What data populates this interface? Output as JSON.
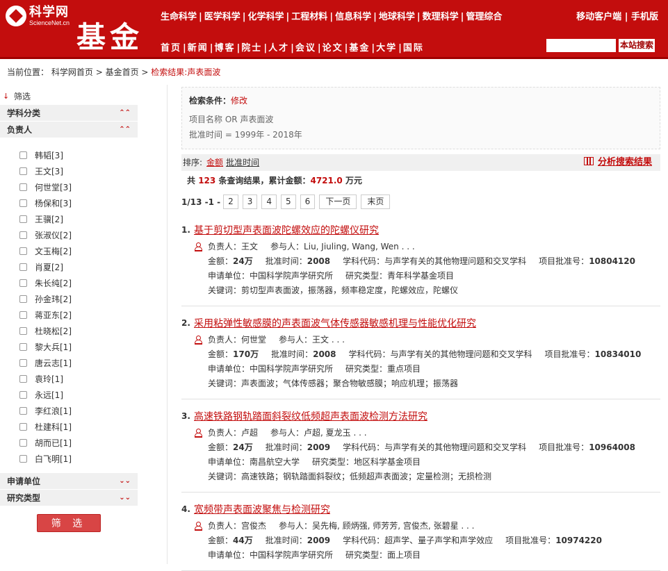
{
  "header": {
    "logo_name": "科学网",
    "logo_sub": "ScienceNet.cn",
    "section": "基金",
    "top_nav": [
      "生命科学",
      "医学科学",
      "化学科学",
      "工程材料",
      "信息科学",
      "地球科学",
      "数理科学",
      "管理综合"
    ],
    "top_right": [
      "移动客户端",
      "手机版"
    ],
    "main_nav": [
      "首页",
      "新闻",
      "博客",
      "院士",
      "人才",
      "会议",
      "论文",
      "基金",
      "大学",
      "国际"
    ],
    "search_value": "",
    "search_button": "本站搜索"
  },
  "breadcrumb": {
    "prefix": "当前位置：",
    "items": [
      "科学网首页",
      "基金首页"
    ],
    "current": "检索结果:声表面波"
  },
  "sidebar": {
    "filter_label": "筛选",
    "categories": [
      {
        "label": "学科分类",
        "chevron": "up"
      },
      {
        "label": "负责人",
        "chevron": "up"
      }
    ],
    "people": [
      "韩韬[3]",
      "王文[3]",
      "何世堂[3]",
      "杨保和[3]",
      "王骥[2]",
      "张淑仪[2]",
      "文玉梅[2]",
      "肖夏[2]",
      "朱长纯[2]",
      "孙金玮[2]",
      "蒋亚东[2]",
      "杜晓松[2]",
      "黎大兵[1]",
      "唐云志[1]",
      "袁玲[1]",
      "永远[1]",
      "李红浪[1]",
      "杜建科[1]",
      "胡而已[1]",
      "白飞明[1]"
    ],
    "bottom_categories": [
      {
        "label": "申请单位",
        "chevron": "down"
      },
      {
        "label": "研究类型",
        "chevron": "down"
      }
    ],
    "filter_button": "筛 选"
  },
  "conditions": {
    "title": "检索条件：",
    "edit": "修改",
    "line1": "项目名称 OR 声表面波",
    "line2": "批准时间 = 1999年 - 2018年"
  },
  "sort": {
    "label": "排序:",
    "option1": "金额",
    "option2": "批准时间",
    "analyze": "分析搜索结果"
  },
  "summary": {
    "pre": "共",
    "count": "123",
    "mid": "条查询结果，累计金额：",
    "amount": "4721.0",
    "unit": "万元"
  },
  "pager": {
    "info": "1/13 -1 -",
    "pages": [
      "2",
      "3",
      "4",
      "5",
      "6"
    ],
    "next": "下一页",
    "last": "末页"
  },
  "results": [
    {
      "idx": "1.",
      "title": "基于剪切型声表面波陀螺效应的陀螺仪研究",
      "leader": "王文",
      "participants": "Liu, Jiuling, Wang, Wen . . .",
      "amount": "24万",
      "year": "2008",
      "subject_code": "与声学有关的其他物理问题和交叉学科",
      "approval_no": "10804120",
      "org": "中国科学院声学研究所",
      "type": "青年科学基金项目",
      "keywords": "剪切型声表面波，振荡器，频率稳定度，陀螺效应，陀螺仪"
    },
    {
      "idx": "2.",
      "title": "采用粘弹性敏感膜的声表面波气体传感器敏感机理与性能优化研究",
      "leader": "何世堂",
      "participants": "王文 . . .",
      "amount": "170万",
      "year": "2008",
      "subject_code": "与声学有关的其他物理问题和交叉学科",
      "approval_no": "10834010",
      "org": "中国科学院声学研究所",
      "type": "重点项目",
      "keywords": "声表面波；气体传感器；聚合物敏感膜；响应机理；振荡器"
    },
    {
      "idx": "3.",
      "title": "高速铁路钢轨踏面斜裂纹低频超声表面波检测方法研究",
      "leader": "卢超",
      "participants": "卢超, 夏龙玉 . . .",
      "amount": "24万",
      "year": "2009",
      "subject_code": "与声学有关的其他物理问题和交叉学科",
      "approval_no": "10964008",
      "org": "南昌航空大学",
      "type": "地区科学基金项目",
      "keywords": "高速铁路；钢轨踏面斜裂纹；低频超声表面波；定量检测；无损检测"
    },
    {
      "idx": "4.",
      "title": "宽频带声表面波聚焦与检测研究",
      "leader": "宫俊杰",
      "participants": "吴先梅, 顾炳强, 师芳芳, 宫俊杰, 张碧星 . . .",
      "amount": "44万",
      "year": "2009",
      "subject_code": "超声学、量子声学和声学效应",
      "approval_no": "10974220",
      "org": "中国科学院声学研究所",
      "type": "面上项目",
      "keywords": ""
    }
  ],
  "labels": {
    "leader": "负责人：",
    "participants": "参与人：",
    "amount": "金额：",
    "year": "批准时间：",
    "subject_code": "学科代码：",
    "approval_no": "项目批准号：",
    "org": "申请单位：",
    "type": "研究类型：",
    "keywords": "关键词："
  }
}
